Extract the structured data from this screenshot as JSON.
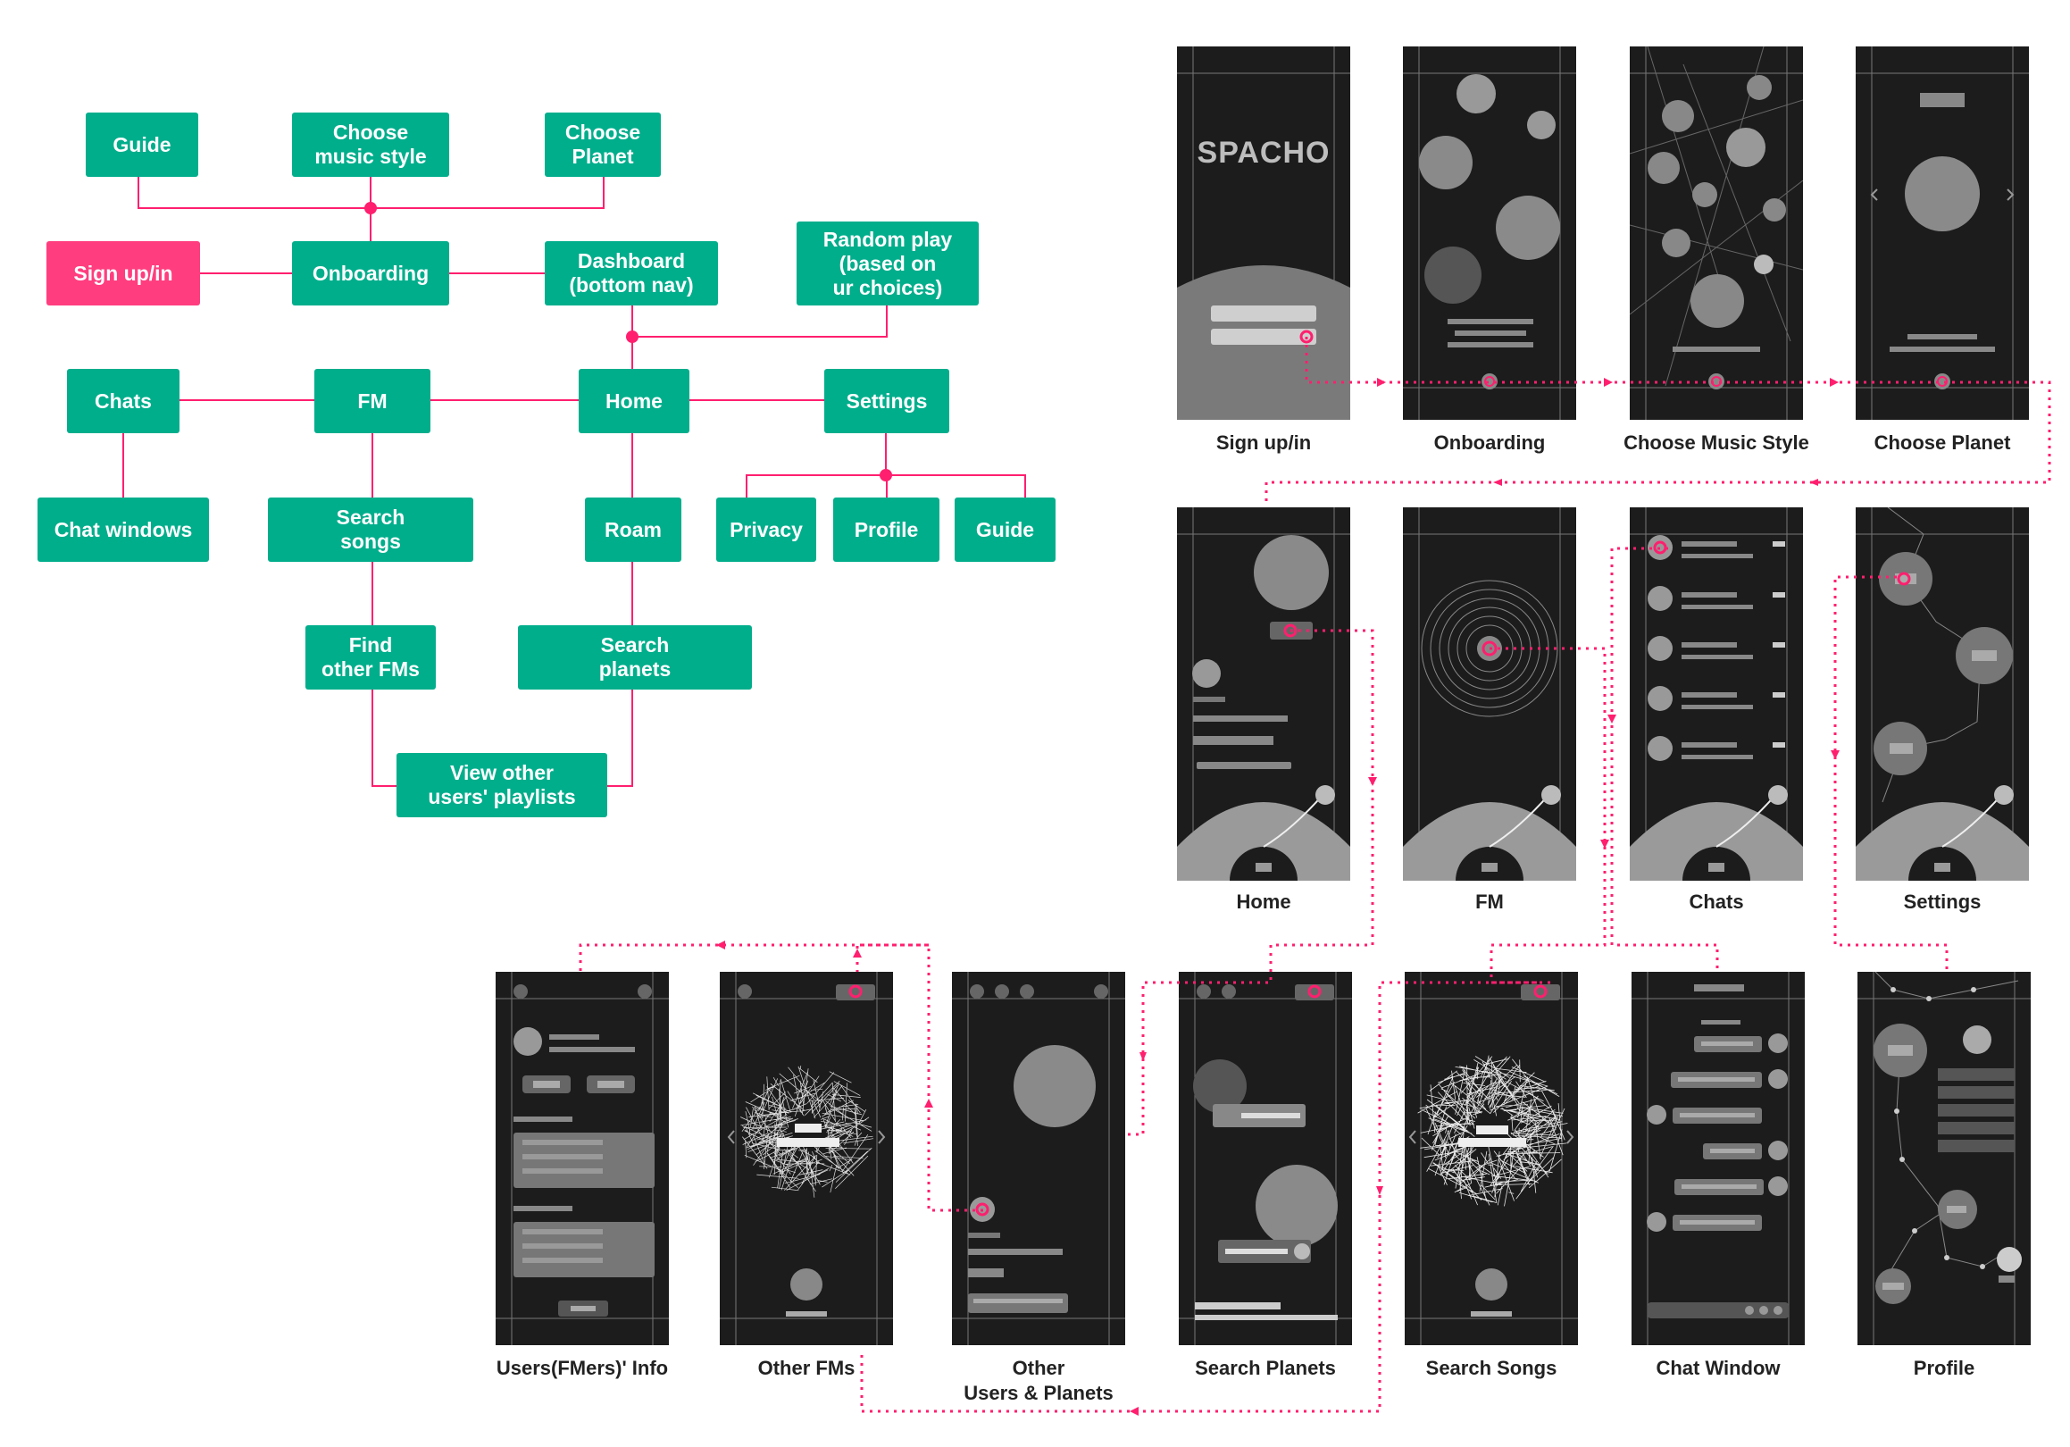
{
  "sitemap": {
    "nodes": {
      "guide_top": "Guide",
      "choose_music_style": "Choose\nmusic style",
      "choose_planet": "Choose\nPlanet",
      "sign_up_in": "Sign up/in",
      "onboarding": "Onboarding",
      "dashboard": "Dashboard\n(bottom nav)",
      "random_play": "Random play\n(based on\nur choices)",
      "chats": "Chats",
      "fm": "FM",
      "home": "Home",
      "settings": "Settings",
      "chat_windows": "Chat windows",
      "search_songs": "Search\nsongs",
      "roam": "Roam",
      "privacy": "Privacy",
      "profile": "Profile",
      "guide_settings": "Guide",
      "find_other_fms": "Find\nother FMs",
      "search_planets": "Search\nplanets",
      "view_other_playlists": "View other\nusers' playlists"
    }
  },
  "wireframes": {
    "row1": [
      "Sign up/in",
      "Onboarding",
      "Choose Music Style",
      "Choose Planet"
    ],
    "row2": [
      "Home",
      "FM",
      "Chats",
      "Settings"
    ],
    "row3": [
      "Users(FMers)' Info",
      "Other FMs",
      "Other\nUsers & Planets",
      "Search Planets",
      "Search Songs",
      "Chat Window",
      "Profile"
    ],
    "logo_text": "SPACHO"
  },
  "colors": {
    "node_green": "#00ae8c",
    "node_pink": "#ff3d7f",
    "connector": "#ff1f6e",
    "screen_bg": "#1c1c1c"
  }
}
